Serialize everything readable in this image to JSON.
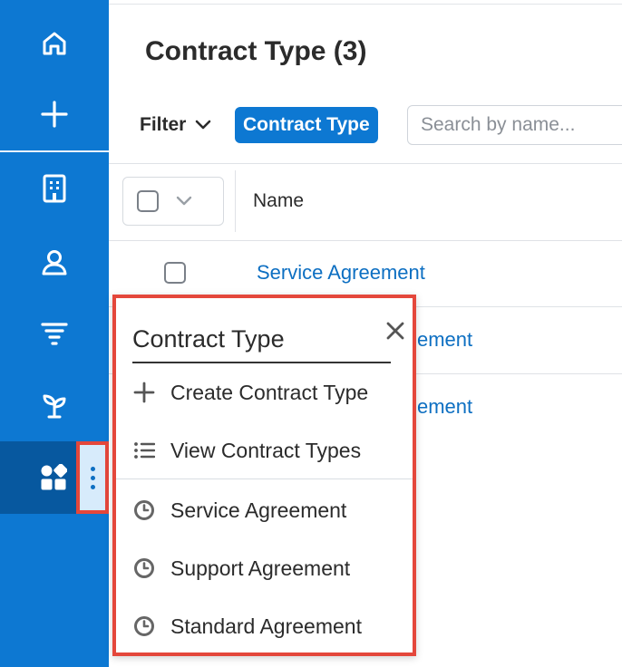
{
  "page": {
    "title": "Contract Type (3)"
  },
  "toolbar": {
    "filter_label": "Filter",
    "active_filter": "Contract Type",
    "search_placeholder": "Search by name..."
  },
  "table": {
    "columns": [
      "Name"
    ],
    "rows": [
      {
        "name": "Service Agreement"
      },
      {
        "name": "Support Agreement"
      },
      {
        "name": "Standard Agreement"
      }
    ],
    "visible_fragments": [
      "ement",
      "ement"
    ]
  },
  "sidebar": {
    "items": [
      {
        "icon": "home-icon"
      },
      {
        "icon": "plus-icon"
      },
      {
        "icon": "building-icon"
      },
      {
        "icon": "contact-icon"
      },
      {
        "icon": "filter-icon"
      },
      {
        "icon": "sprout-icon"
      },
      {
        "icon": "modules-icon"
      }
    ]
  },
  "popup": {
    "title": "Contract Type",
    "actions": [
      {
        "label": "Create Contract Type",
        "icon": "plus-icon"
      },
      {
        "label": "View Contract Types",
        "icon": "list-icon"
      }
    ],
    "recent": [
      {
        "label": "Service Agreement",
        "icon": "clock-icon"
      },
      {
        "label": "Support Agreement",
        "icon": "clock-icon"
      },
      {
        "label": "Standard Agreement",
        "icon": "clock-icon"
      }
    ]
  },
  "colors": {
    "sidebar": "#0d78d2",
    "sidebar_active": "#07589f",
    "link": "#0d6fc2",
    "highlight_border": "#e4473b"
  }
}
